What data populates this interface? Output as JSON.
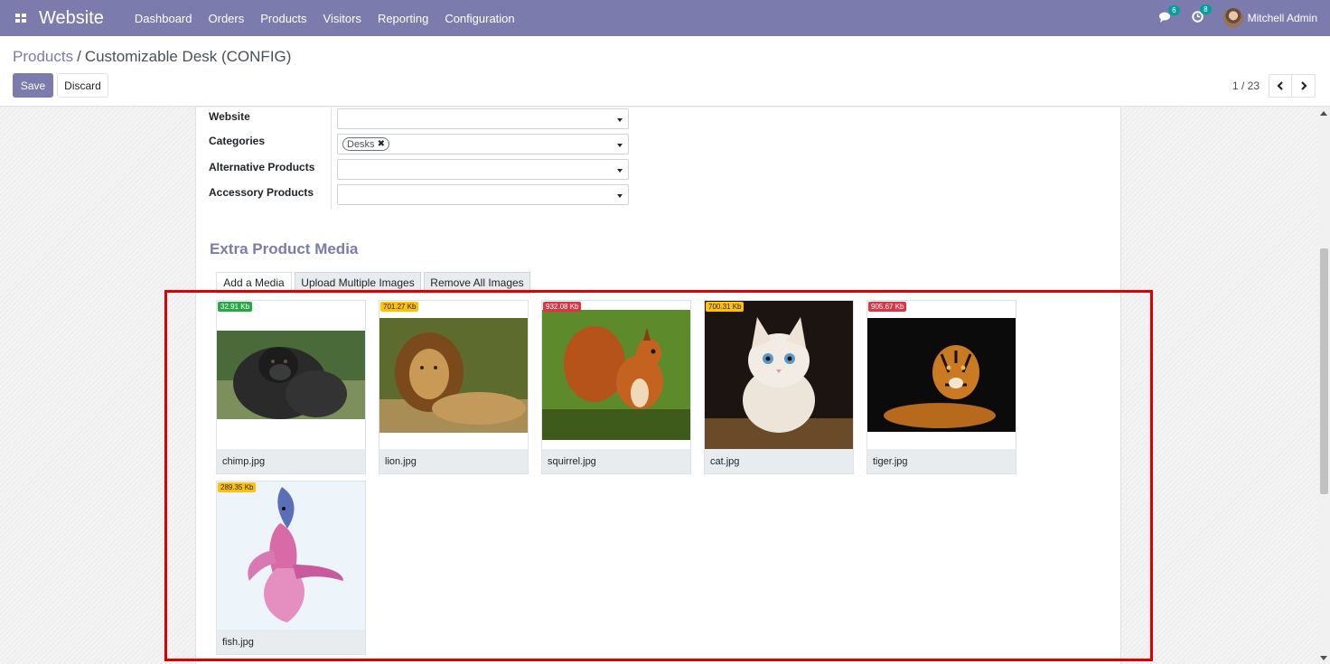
{
  "navbar": {
    "app_name": "Website",
    "menu": [
      "Dashboard",
      "Orders",
      "Products",
      "Visitors",
      "Reporting",
      "Configuration"
    ],
    "chat_count": "6",
    "activity_count": "8",
    "user_name": "Mitchell Admin",
    "bg_color": "#7c7bad"
  },
  "control_panel": {
    "breadcrumb_parent": "Products",
    "breadcrumb_separator": "/",
    "breadcrumb_current": "Customizable Desk (CONFIG)",
    "save_label": "Save",
    "discard_label": "Discard",
    "pager_value": "1 / 23"
  },
  "form": {
    "fields": [
      {
        "label": "Website",
        "value": ""
      },
      {
        "label": "Categories",
        "tags": [
          "Desks"
        ]
      },
      {
        "label": "Alternative Products",
        "value": ""
      },
      {
        "label": "Accessory Products",
        "value": ""
      }
    ]
  },
  "media_section": {
    "title": "Extra Product Media",
    "add_label": "Add a Media",
    "upload_label": "Upload Multiple Images",
    "remove_label": "Remove All Images",
    "items": [
      {
        "name": "chimp.jpg",
        "size": "32.91 Kb",
        "badge_color": "#28a745",
        "image": "gorilla"
      },
      {
        "name": "lion.jpg",
        "size": "701.27 Kb",
        "badge_color": "#ffc107",
        "image": "lion"
      },
      {
        "name": "squirrel.jpg",
        "size": "932.08 Kb",
        "badge_color": "#dc3545",
        "image": "squirrel"
      },
      {
        "name": "cat.jpg",
        "size": "700.31 Kb",
        "badge_color": "#ffc107",
        "image": "kitten"
      },
      {
        "name": "tiger.jpg",
        "size": "905.67 Kb",
        "badge_color": "#dc3545",
        "image": "tiger"
      },
      {
        "name": "fish.jpg",
        "size": "289.35 Kb",
        "badge_color": "#ffc107",
        "image": "betta-fish"
      }
    ]
  }
}
